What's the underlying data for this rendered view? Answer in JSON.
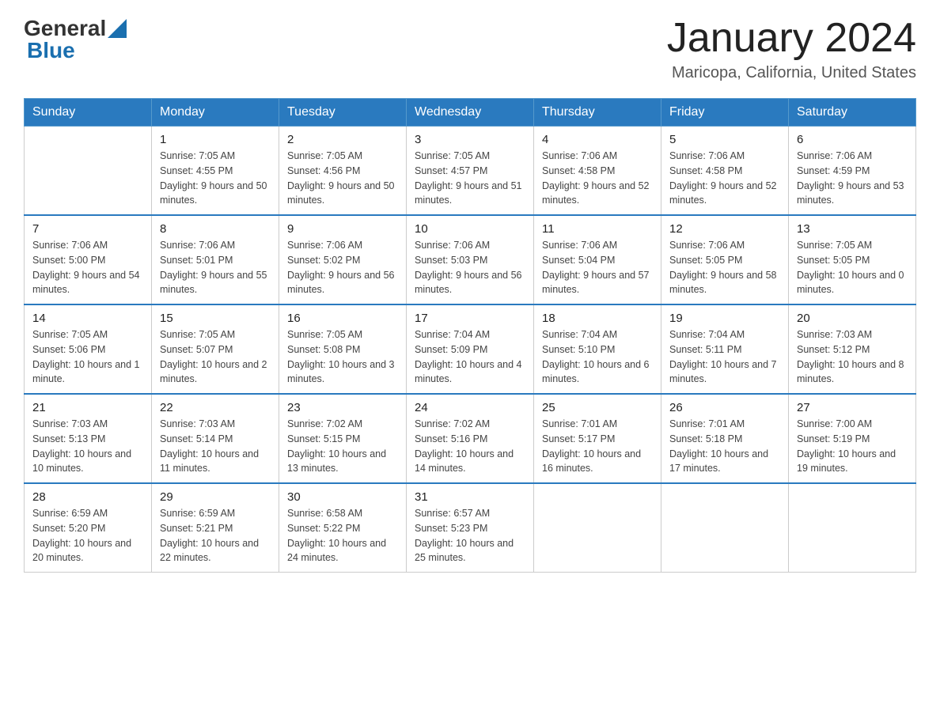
{
  "header": {
    "logo": {
      "general": "General",
      "blue": "Blue",
      "tagline": "GeneralBlue"
    },
    "title": "January 2024",
    "subtitle": "Maricopa, California, United States"
  },
  "days_of_week": [
    "Sunday",
    "Monday",
    "Tuesday",
    "Wednesday",
    "Thursday",
    "Friday",
    "Saturday"
  ],
  "weeks": [
    {
      "days": [
        {
          "number": "",
          "sunrise": "",
          "sunset": "",
          "daylight": ""
        },
        {
          "number": "1",
          "sunrise": "Sunrise: 7:05 AM",
          "sunset": "Sunset: 4:55 PM",
          "daylight": "Daylight: 9 hours and 50 minutes."
        },
        {
          "number": "2",
          "sunrise": "Sunrise: 7:05 AM",
          "sunset": "Sunset: 4:56 PM",
          "daylight": "Daylight: 9 hours and 50 minutes."
        },
        {
          "number": "3",
          "sunrise": "Sunrise: 7:05 AM",
          "sunset": "Sunset: 4:57 PM",
          "daylight": "Daylight: 9 hours and 51 minutes."
        },
        {
          "number": "4",
          "sunrise": "Sunrise: 7:06 AM",
          "sunset": "Sunset: 4:58 PM",
          "daylight": "Daylight: 9 hours and 52 minutes."
        },
        {
          "number": "5",
          "sunrise": "Sunrise: 7:06 AM",
          "sunset": "Sunset: 4:58 PM",
          "daylight": "Daylight: 9 hours and 52 minutes."
        },
        {
          "number": "6",
          "sunrise": "Sunrise: 7:06 AM",
          "sunset": "Sunset: 4:59 PM",
          "daylight": "Daylight: 9 hours and 53 minutes."
        }
      ]
    },
    {
      "days": [
        {
          "number": "7",
          "sunrise": "Sunrise: 7:06 AM",
          "sunset": "Sunset: 5:00 PM",
          "daylight": "Daylight: 9 hours and 54 minutes."
        },
        {
          "number": "8",
          "sunrise": "Sunrise: 7:06 AM",
          "sunset": "Sunset: 5:01 PM",
          "daylight": "Daylight: 9 hours and 55 minutes."
        },
        {
          "number": "9",
          "sunrise": "Sunrise: 7:06 AM",
          "sunset": "Sunset: 5:02 PM",
          "daylight": "Daylight: 9 hours and 56 minutes."
        },
        {
          "number": "10",
          "sunrise": "Sunrise: 7:06 AM",
          "sunset": "Sunset: 5:03 PM",
          "daylight": "Daylight: 9 hours and 56 minutes."
        },
        {
          "number": "11",
          "sunrise": "Sunrise: 7:06 AM",
          "sunset": "Sunset: 5:04 PM",
          "daylight": "Daylight: 9 hours and 57 minutes."
        },
        {
          "number": "12",
          "sunrise": "Sunrise: 7:06 AM",
          "sunset": "Sunset: 5:05 PM",
          "daylight": "Daylight: 9 hours and 58 minutes."
        },
        {
          "number": "13",
          "sunrise": "Sunrise: 7:05 AM",
          "sunset": "Sunset: 5:05 PM",
          "daylight": "Daylight: 10 hours and 0 minutes."
        }
      ]
    },
    {
      "days": [
        {
          "number": "14",
          "sunrise": "Sunrise: 7:05 AM",
          "sunset": "Sunset: 5:06 PM",
          "daylight": "Daylight: 10 hours and 1 minute."
        },
        {
          "number": "15",
          "sunrise": "Sunrise: 7:05 AM",
          "sunset": "Sunset: 5:07 PM",
          "daylight": "Daylight: 10 hours and 2 minutes."
        },
        {
          "number": "16",
          "sunrise": "Sunrise: 7:05 AM",
          "sunset": "Sunset: 5:08 PM",
          "daylight": "Daylight: 10 hours and 3 minutes."
        },
        {
          "number": "17",
          "sunrise": "Sunrise: 7:04 AM",
          "sunset": "Sunset: 5:09 PM",
          "daylight": "Daylight: 10 hours and 4 minutes."
        },
        {
          "number": "18",
          "sunrise": "Sunrise: 7:04 AM",
          "sunset": "Sunset: 5:10 PM",
          "daylight": "Daylight: 10 hours and 6 minutes."
        },
        {
          "number": "19",
          "sunrise": "Sunrise: 7:04 AM",
          "sunset": "Sunset: 5:11 PM",
          "daylight": "Daylight: 10 hours and 7 minutes."
        },
        {
          "number": "20",
          "sunrise": "Sunrise: 7:03 AM",
          "sunset": "Sunset: 5:12 PM",
          "daylight": "Daylight: 10 hours and 8 minutes."
        }
      ]
    },
    {
      "days": [
        {
          "number": "21",
          "sunrise": "Sunrise: 7:03 AM",
          "sunset": "Sunset: 5:13 PM",
          "daylight": "Daylight: 10 hours and 10 minutes."
        },
        {
          "number": "22",
          "sunrise": "Sunrise: 7:03 AM",
          "sunset": "Sunset: 5:14 PM",
          "daylight": "Daylight: 10 hours and 11 minutes."
        },
        {
          "number": "23",
          "sunrise": "Sunrise: 7:02 AM",
          "sunset": "Sunset: 5:15 PM",
          "daylight": "Daylight: 10 hours and 13 minutes."
        },
        {
          "number": "24",
          "sunrise": "Sunrise: 7:02 AM",
          "sunset": "Sunset: 5:16 PM",
          "daylight": "Daylight: 10 hours and 14 minutes."
        },
        {
          "number": "25",
          "sunrise": "Sunrise: 7:01 AM",
          "sunset": "Sunset: 5:17 PM",
          "daylight": "Daylight: 10 hours and 16 minutes."
        },
        {
          "number": "26",
          "sunrise": "Sunrise: 7:01 AM",
          "sunset": "Sunset: 5:18 PM",
          "daylight": "Daylight: 10 hours and 17 minutes."
        },
        {
          "number": "27",
          "sunrise": "Sunrise: 7:00 AM",
          "sunset": "Sunset: 5:19 PM",
          "daylight": "Daylight: 10 hours and 19 minutes."
        }
      ]
    },
    {
      "days": [
        {
          "number": "28",
          "sunrise": "Sunrise: 6:59 AM",
          "sunset": "Sunset: 5:20 PM",
          "daylight": "Daylight: 10 hours and 20 minutes."
        },
        {
          "number": "29",
          "sunrise": "Sunrise: 6:59 AM",
          "sunset": "Sunset: 5:21 PM",
          "daylight": "Daylight: 10 hours and 22 minutes."
        },
        {
          "number": "30",
          "sunrise": "Sunrise: 6:58 AM",
          "sunset": "Sunset: 5:22 PM",
          "daylight": "Daylight: 10 hours and 24 minutes."
        },
        {
          "number": "31",
          "sunrise": "Sunrise: 6:57 AM",
          "sunset": "Sunset: 5:23 PM",
          "daylight": "Daylight: 10 hours and 25 minutes."
        },
        {
          "number": "",
          "sunrise": "",
          "sunset": "",
          "daylight": ""
        },
        {
          "number": "",
          "sunrise": "",
          "sunset": "",
          "daylight": ""
        },
        {
          "number": "",
          "sunrise": "",
          "sunset": "",
          "daylight": ""
        }
      ]
    }
  ]
}
